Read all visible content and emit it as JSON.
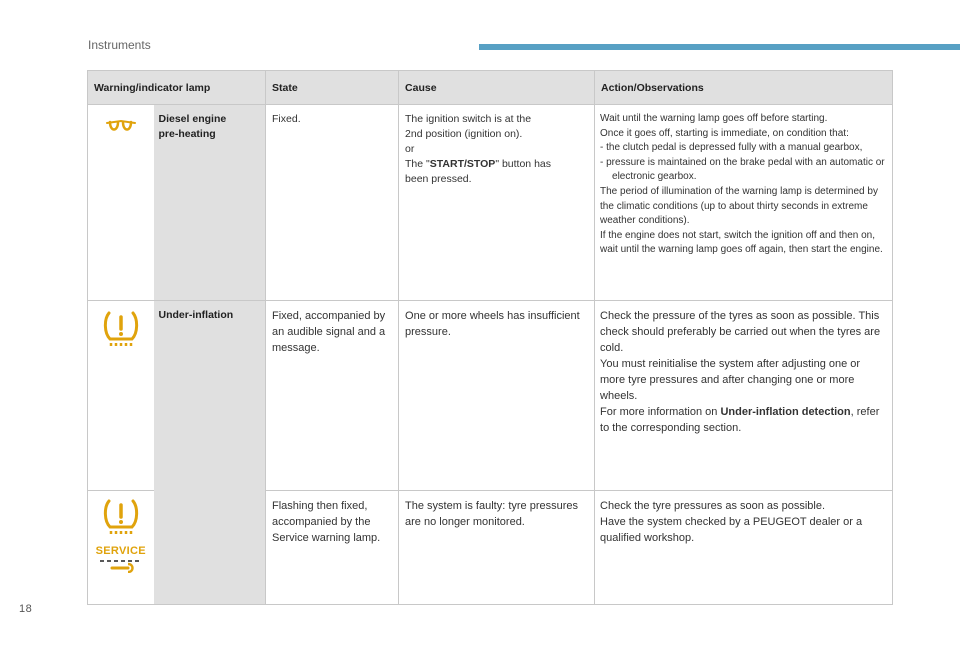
{
  "header": {
    "section": "Instruments"
  },
  "page_number": "18",
  "table": {
    "columns": [
      "Warning/indicator lamp",
      "State",
      "Cause",
      "Action/Observations"
    ],
    "rows": {
      "preheat": {
        "icon": "glow-plug-icon",
        "name_line1": "Diesel engine",
        "name_line2": "pre-heating",
        "state": "Fixed.",
        "cause_line1": "The ignition switch is at the",
        "cause_line2": "2nd position (ignition on).",
        "cause_or": "or",
        "cause_pre": "The \"",
        "cause_bold": "START/STOP",
        "cause_post": "\" button has",
        "cause_line5": "been pressed.",
        "action_line1": "Wait until the warning lamp goes off before starting.",
        "action_line2": "Once it goes off, starting is immediate, on condition that:",
        "action_dash1": "-   the clutch pedal is depressed fully with a manual gearbox,",
        "action_dash2": "-   pressure is maintained on the brake pedal with an automatic or electronic gearbox.",
        "action_para2": "The period of illumination of the warning lamp is determined by the climatic conditions (up to about thirty seconds in extreme weather conditions).",
        "action_para3": "If the engine does not start, switch the ignition off and then on, wait until the warning lamp goes off again, then start the engine."
      },
      "underinflation": {
        "icon": "tyre-pressure-warning-icon",
        "name": "Under-inflation",
        "state": "Fixed, accompanied by an audible signal and a message.",
        "cause": "One or more wheels has insufficient pressure.",
        "action_para1": "Check the pressure of the tyres as soon as possible. This check should preferably be carried out when the tyres are cold.",
        "action_para2": "You must reinitialise the system after adjusting one or more tyre pressures and after changing one or more wheels.",
        "action_pre": "For more information on ",
        "action_bold": "Under-inflation detection",
        "action_post": ", refer to the corresponding section."
      },
      "fault": {
        "icon": "tyre-pressure-service-icon",
        "service_text": "SERVICE",
        "state": "Flashing then fixed, accompanied by the Service warning lamp.",
        "cause": "The system is faulty: tyre pressures are no longer monitored.",
        "action_line1": "Check the tyre pressures as soon as possible.",
        "action_line2": "Have the system checked by a PEUGEOT dealer or a qualified workshop."
      }
    }
  },
  "colors": {
    "accent": "#57a0c4",
    "icon_amber": "#e0a30c",
    "header_bg": "#e0e0e0"
  }
}
